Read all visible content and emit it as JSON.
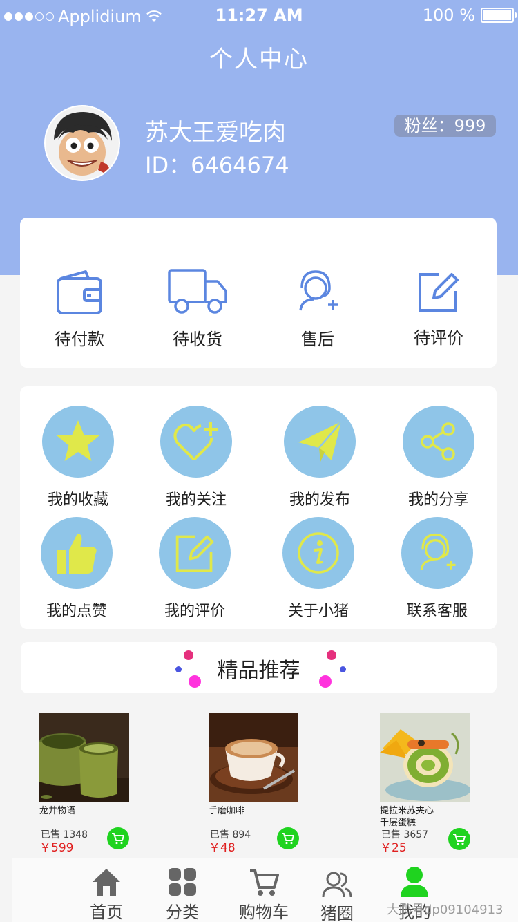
{
  "status_bar": {
    "carrier": "Applidium",
    "time": "11:27 AM",
    "battery": "100 %"
  },
  "header": {
    "title": "个人中心"
  },
  "profile": {
    "name": "苏大王爱吃肉",
    "id": "ID：6464674",
    "fans": "粉丝：999"
  },
  "orders": [
    {
      "label": "待付款",
      "icon": "wallet-icon"
    },
    {
      "label": "待收货",
      "icon": "truck-icon"
    },
    {
      "label": "售后",
      "icon": "customer-service-icon"
    },
    {
      "label": "待评价",
      "icon": "edit-icon"
    }
  ],
  "services": [
    {
      "label": "我的收藏",
      "icon": "star-icon"
    },
    {
      "label": "我的关注",
      "icon": "heart-plus-icon"
    },
    {
      "label": "我的发布",
      "icon": "paper-plane-icon"
    },
    {
      "label": "我的分享",
      "icon": "share-icon"
    },
    {
      "label": "我的点赞",
      "icon": "thumbs-up-icon"
    },
    {
      "label": "我的评价",
      "icon": "edit-icon"
    },
    {
      "label": "关于小猪",
      "icon": "info-icon"
    },
    {
      "label": "联系客服",
      "icon": "customer-service-icon"
    }
  ],
  "recommend": {
    "title": "精品推荐"
  },
  "products": [
    {
      "name": "龙井物语",
      "sold": "已售 1348",
      "price": "￥599"
    },
    {
      "name": "手磨咖啡",
      "sold": "已售 894",
      "price": "￥48"
    },
    {
      "name": "提拉米苏夹心\n千层蛋糕",
      "sold": "已售 3657",
      "price": "￥25"
    }
  ],
  "tabs": [
    {
      "label": "首页",
      "icon": "home-icon",
      "active": false
    },
    {
      "label": "分类",
      "icon": "grid-icon",
      "active": false
    },
    {
      "label": "购物车",
      "icon": "cart-icon",
      "active": false
    },
    {
      "label": "猪圈",
      "icon": "group-icon",
      "active": false
    },
    {
      "label": "我的",
      "icon": "user-icon",
      "active": true
    }
  ],
  "watermark": "大鹏号dp09104913",
  "colors": {
    "header_bg": "#99b4ef",
    "icon_blue": "#5b86e0",
    "service_circle": "#8fc5e8",
    "service_icon": "#e0e84a",
    "cart_green": "#1fd31f",
    "price_red": "#e02020",
    "active_tab": "#1fd31f"
  }
}
